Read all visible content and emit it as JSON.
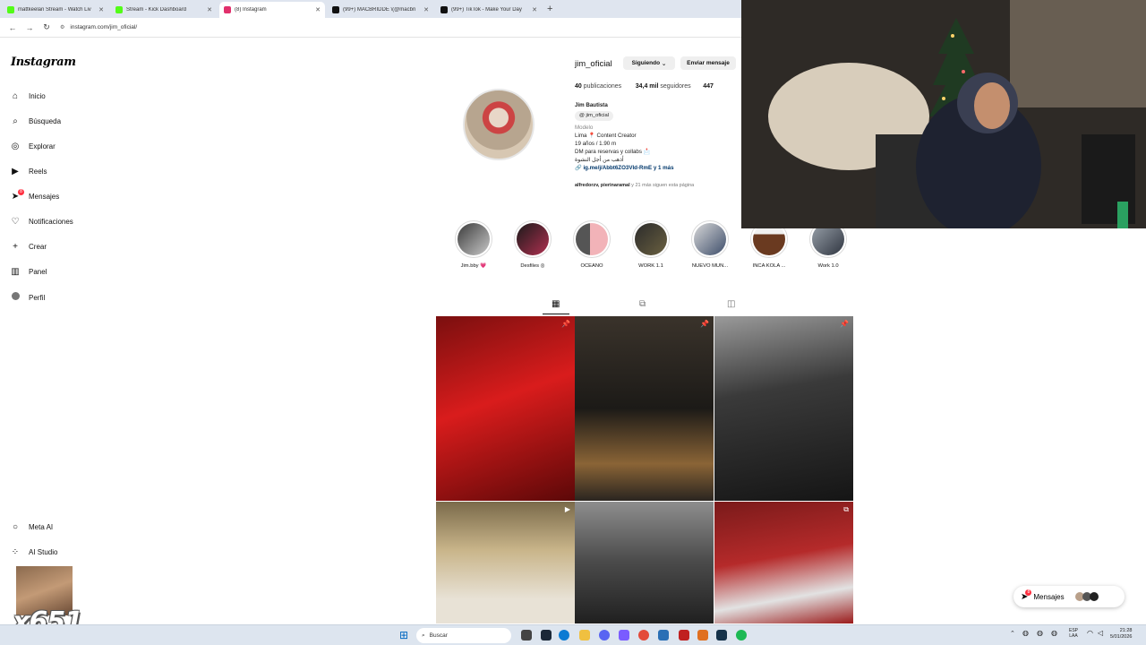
{
  "browser": {
    "tabs": [
      {
        "title": "mattkeelan Stream - Watch Liv",
        "color": "#53fc18"
      },
      {
        "title": "Stream - Kick Dashboard",
        "color": "#53fc18"
      },
      {
        "title": "(8) Instagram",
        "color": "#e1306c"
      },
      {
        "title": "(99+) MACBRIDDE \\(@macbri",
        "color": "#111111"
      },
      {
        "title": "(99+) TikTok - Make Your Day",
        "color": "#111111"
      }
    ],
    "new_tab": "+",
    "url": "instagram.com/jim_oficial/"
  },
  "sidebar": {
    "logo": "Instagram",
    "items": [
      {
        "label": "Inicio",
        "icon": "⌂"
      },
      {
        "label": "Búsqueda",
        "icon": "⌕"
      },
      {
        "label": "Explorar",
        "icon": "◎"
      },
      {
        "label": "Reels",
        "icon": "▶"
      },
      {
        "label": "Mensajes",
        "icon": "➤",
        "badge": "8"
      },
      {
        "label": "Notificaciones",
        "icon": "♡"
      },
      {
        "label": "Crear",
        "icon": "+"
      },
      {
        "label": "Panel",
        "icon": "▥"
      },
      {
        "label": "Perfil",
        "icon": "●"
      }
    ],
    "bottom_items": [
      {
        "label": "Meta AI",
        "icon": "○"
      },
      {
        "label": "AI Studio",
        "icon": "⁘"
      }
    ]
  },
  "profile": {
    "username": "jim_oficial",
    "following_button": "Siguiendo",
    "message_button": "Enviar mensaje",
    "posts_count": "40",
    "posts_label": "publicaciones",
    "followers_count": "34,4 mil",
    "followers_label": "seguidores",
    "following_count": "447",
    "name": "Jim Bautista",
    "threads_handle": "jim_oficial",
    "category": "Modelo",
    "bio_lines": [
      "Lima 📍 Content Creator",
      "19 años / 1.90 m",
      "DM para reservas y collabs 📩",
      "أذهب من أجل النشوة"
    ],
    "link": "ig.me/j/Abbt6ZO3Vld-RmE y 1 más",
    "followed_by_names": "alfredorzv, pierinaramal",
    "followed_by_rest": " y 21 más siguen esta página"
  },
  "highlights": [
    {
      "label": "Jim.bby 💗",
      "color1": "#3a3a3a",
      "color2": "#c9c9c9"
    },
    {
      "label": "Desfiles ◎",
      "color1": "#1a1a1a",
      "color2": "#b03050"
    },
    {
      "label": "OCEANO",
      "color1": "#f2b3b8",
      "color2": "#555555"
    },
    {
      "label": "WORK 1.1",
      "color1": "#2b2b2b",
      "color2": "#6a6040"
    },
    {
      "label": "NUEVO MUN...",
      "color1": "#3d4d6a",
      "color2": "#d8d8d8"
    },
    {
      "label": "INCA KOLA ...",
      "color1": "#f0f0f0",
      "color2": "#6a3a20"
    },
    {
      "label": "Work 1.0",
      "color1": "#2f3540",
      "color2": "#9aa2ab"
    }
  ],
  "profile_tabs": [
    {
      "name": "posts",
      "icon": "▦"
    },
    {
      "name": "reels",
      "icon": "⧉"
    },
    {
      "name": "tagged",
      "icon": "◫"
    }
  ],
  "posts": [
    {
      "bg": "linear-gradient(160deg,#7a0f0f,#d91c1c 45%,#5c0808)",
      "pin": "📌"
    },
    {
      "bg": "linear-gradient(180deg,#3a332b,#1c1a17 50%,#8a6436 80%,#2a2520)",
      "pin": "📌"
    },
    {
      "bg": "linear-gradient(170deg,#9a9a9a,#3a3a3a 40%,#151515)",
      "pin": "📌"
    },
    {
      "bg": "linear-gradient(180deg,#7a6a4a,#c9b58a 40%,#e8e2d6 80%)",
      "pin": "▶"
    },
    {
      "bg": "linear-gradient(180deg,#8e8e8e,#4a4a4a 50%,#202020)",
      "pin": ""
    },
    {
      "bg": "linear-gradient(170deg,#7a1a1a,#b52a2a 45%,#e2e2e2 75%,#9b1b1b)",
      "pin": "⧉"
    }
  ],
  "messages_pill": {
    "label": "Mensajes",
    "badge": "8"
  },
  "emote": {
    "count": "x651"
  },
  "taskbar": {
    "search_placeholder": "Buscar",
    "lang": "ESP",
    "lang2": "LAA",
    "time": "21:28",
    "date": "5/01/2026"
  }
}
